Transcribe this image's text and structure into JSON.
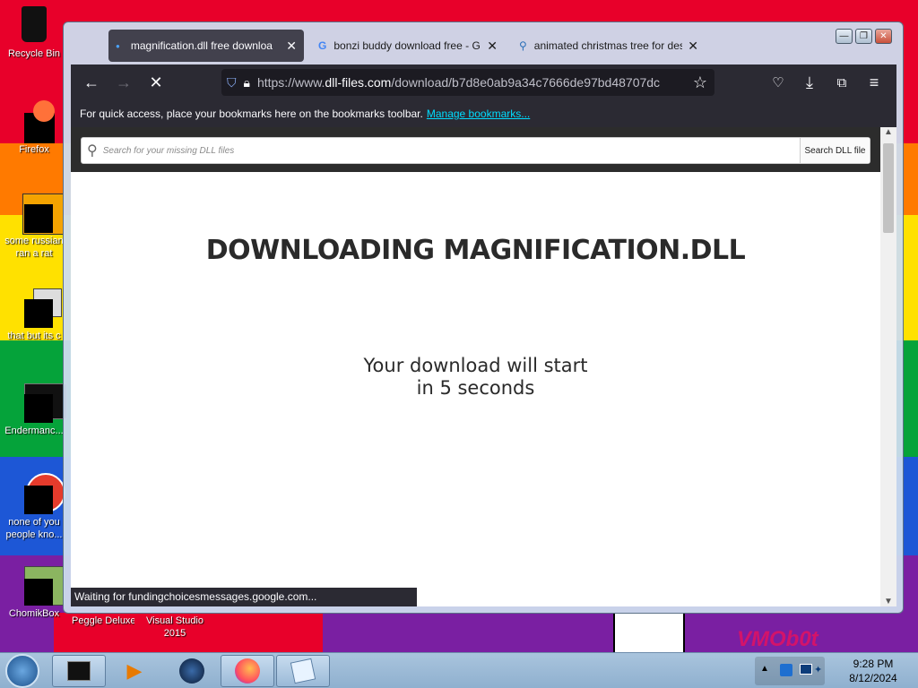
{
  "theme": {
    "accent": "#00ddff",
    "browser_dark": "#2b2a33",
    "site_header": "#2c2c2c"
  },
  "desktop": {
    "icons": [
      {
        "label": "Recycle Bin",
        "icon": "recycle-bin-icon"
      },
      {
        "label": "Firefox",
        "icon": "firefox-icon"
      },
      {
        "label": "some russian",
        "label2": "ran a rat",
        "icon": "program-icon"
      },
      {
        "label": "that but its c",
        "icon": "copy-icon"
      },
      {
        "label": "Endermanc...",
        "icon": "terminal-icon"
      },
      {
        "label": "none of you",
        "label2": "people kno...",
        "icon": "program-icon"
      },
      {
        "label": "ChomikBox",
        "icon": "chomikbox-icon"
      },
      {
        "label": "Peggle Deluxe",
        "icon": "peggle-icon"
      },
      {
        "label": "Visual Studio",
        "label2": "2015",
        "icon": "visual-studio-icon"
      }
    ]
  },
  "browser": {
    "tabs": [
      {
        "title": "magnification.dll free downloa",
        "icon": "site-favicon",
        "close": "✕"
      },
      {
        "title": "bonzi buddy download free - G",
        "icon": "google-icon",
        "close": "✕"
      },
      {
        "title": "animated christmas tree for des",
        "icon": "search-icon",
        "close": "✕"
      }
    ],
    "url_prefix": "https://www.",
    "url_domain": "dll-files.com",
    "url_path": "/download/b7d8e0ab9a34c7666de97bd48707dc",
    "bookmarks_text": "For quick access, place your bookmarks here on the bookmarks toolbar.",
    "bookmarks_link": "Manage bookmarks...",
    "status_text": "Waiting for fundingchoicesmessages.google.com..."
  },
  "page": {
    "search_placeholder": "Search for your missing DLL files",
    "search_button": "Search DLL file",
    "heading": "DOWNLOADING MAGNIFICATION.DLL",
    "message_line1": "Your download will start",
    "message_line2": "in 5 seconds"
  },
  "taskbar": {
    "time": "9:28 PM",
    "date": "8/12/2024",
    "apps": [
      "terminal-icon",
      "media-player-icon",
      "browser-globe-icon",
      "firefox-icon",
      "notepad-icon"
    ]
  },
  "wallpaper": {
    "text": "VMOb0t"
  }
}
